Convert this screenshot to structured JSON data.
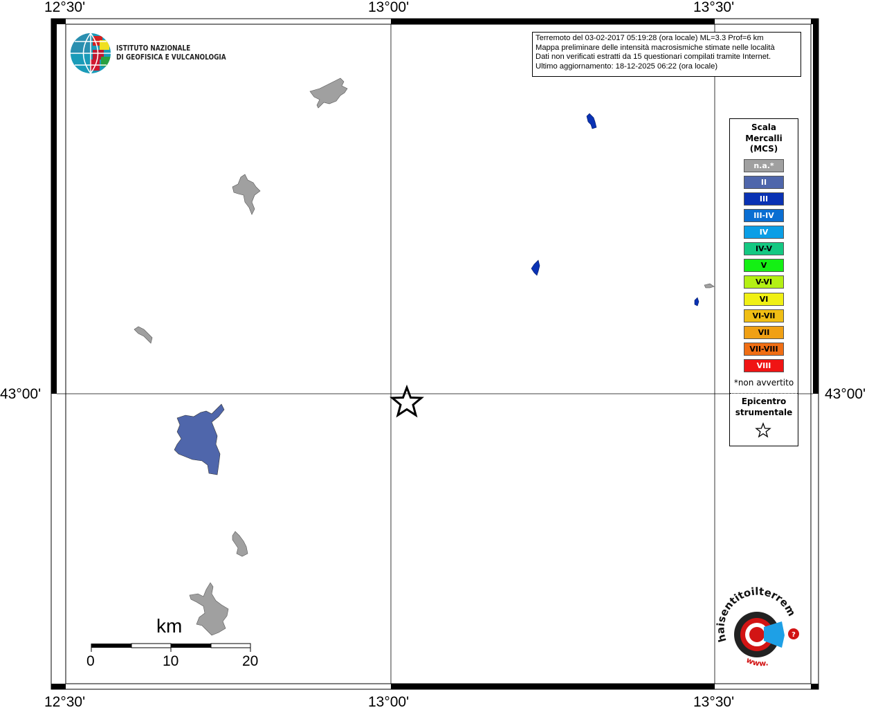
{
  "coords": {
    "top": [
      "12°30'",
      "13°00'",
      "13°30'"
    ],
    "bottom": [
      "12°30'",
      "13°00'",
      "13°30'"
    ],
    "left_lat": "43°00'",
    "right_lat": "43°00'"
  },
  "info": {
    "line1": "Terremoto del 03-02-2017 05:19:28 (ora locale) ML=3.3 Prof=6 km",
    "line2": "Mappa preliminare delle intensità macrosismiche stimate nelle località",
    "line3": "Dati non verificati estratti da 15 questionari compilati tramite Internet.",
    "line4": "Ultimo aggiornamento: 18-12-2025 06:22 (ora locale)"
  },
  "logo": {
    "line1": "ISTITUTO NAZIONALE",
    "line2": "DI GEOFISICA E VULCANOLOGIA"
  },
  "legend": {
    "title1": "Scala",
    "title2": "Mercalli",
    "title3": "(MCS)",
    "items": [
      {
        "label": "n.a.*",
        "color": "#a0a0a0"
      },
      {
        "label": "II",
        "color": "#4f66ab"
      },
      {
        "label": "III",
        "color": "#0a32b4"
      },
      {
        "label": "III-IV",
        "color": "#0a6ed2"
      },
      {
        "label": "IV",
        "color": "#0a9ee6"
      },
      {
        "label": "IV-V",
        "color": "#14c882"
      },
      {
        "label": "V",
        "color": "#14f014"
      },
      {
        "label": "V-VI",
        "color": "#b4f014"
      },
      {
        "label": "VI",
        "color": "#f0f014"
      },
      {
        "label": "VI-VII",
        "color": "#f0be14"
      },
      {
        "label": "VII",
        "color": "#f0a014"
      },
      {
        "label": "VII-VIII",
        "color": "#f06e14"
      },
      {
        "label": "VIII",
        "color": "#f01414"
      }
    ],
    "note": "*non avvertito",
    "epicentro1": "Epicentro",
    "epicentro2": "strumentale"
  },
  "scalebar": {
    "unit": "km",
    "labels": [
      "0",
      "10",
      "20"
    ]
  },
  "places": {
    "colors": {
      "na": "#a0a0a0",
      "ii": "#4f66ab",
      "iii": "#0a32b4"
    }
  }
}
